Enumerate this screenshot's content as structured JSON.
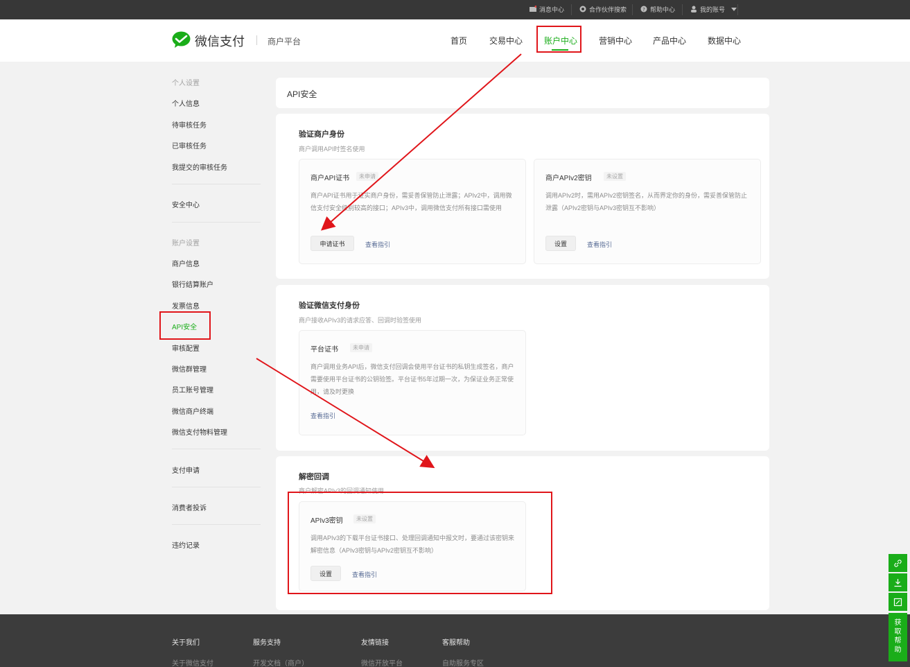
{
  "topbar": {
    "items": [
      {
        "label": "消息中心",
        "icon": "mail-icon"
      },
      {
        "label": "合作伙伴搜索",
        "icon": "partner-icon"
      },
      {
        "label": "帮助中心",
        "icon": "help-icon"
      },
      {
        "label": "我的账号",
        "icon": "user-icon"
      }
    ]
  },
  "header": {
    "logo_text": "微信支付",
    "platform": "商户平台",
    "nav": [
      "首页",
      "交易中心",
      "账户中心",
      "营销中心",
      "产品中心",
      "数据中心"
    ],
    "active_nav": "账户中心"
  },
  "sidebar": {
    "group_personal": "个人设置",
    "personal_items": [
      "个人信息",
      "待审核任务",
      "已审核任务",
      "我提交的审核任务"
    ],
    "security": "安全中心",
    "group_account": "账户设置",
    "account_items": [
      "商户信息",
      "银行结算账户",
      "发票信息",
      "API安全",
      "审核配置",
      "微信群管理",
      "员工账号管理",
      "微信商户终端",
      "微信支付物料管理"
    ],
    "active_item": "API安全",
    "pay_apply": "支付申请",
    "complaint": "消费者投诉",
    "violation": "违约记录"
  },
  "main": {
    "page_title": "API安全",
    "section1": {
      "title": "验证商户身份",
      "desc": "商户调用API时签名使用",
      "card1": {
        "title": "商户API证书",
        "badge": "未申请",
        "desc": "商户API证书用于证实商户身份，需妥善保管防止泄露；APIv2中，调用微信支付安全级别较高的接口；APIv3中，调用微信支付所有接口需使用",
        "button": "申请证书",
        "link": "查看指引"
      },
      "card2": {
        "title": "商户APIv2密钥",
        "badge": "未设置",
        "desc": "调用APIv2时，需用APIv2密钥签名，从而界定你的身份，需妥善保管防止泄露（APIv2密钥与APIv3密钥互不影响）",
        "button": "设置",
        "link": "查看指引"
      }
    },
    "section2": {
      "title": "验证微信支付身份",
      "desc": "商户接收APIv3的请求应答、回调时验签使用",
      "card1": {
        "title": "平台证书",
        "badge": "未申请",
        "desc": "商户调用业务API后，微信支付回调会使用平台证书的私钥生成签名，商户需要使用平台证书的公钥验签。平台证书5年过期一次，为保证业务正常使用，请及时更换",
        "link": "查看指引"
      }
    },
    "section3": {
      "title": "解密回调",
      "desc": "商户解密APIv3的回调通知使用",
      "card1": {
        "title": "APIv3密钥",
        "badge": "未设置",
        "desc": "调用APIv3的下载平台证书接口、处理回调通知中报文时，要通过该密钥来解密信息（APIv3密钥与APIv2密钥互不影响）",
        "button": "设置",
        "link": "查看指引"
      }
    }
  },
  "footer": {
    "headings": [
      "关于我们",
      "服务支持",
      "友情链接",
      "客服帮助"
    ],
    "links": [
      "关于微信支付",
      "开发文档（商户）",
      "微信开放平台",
      "自助服务专区"
    ]
  },
  "float": {
    "help_label": "获取帮助",
    "icons": [
      "link-icon",
      "download-icon",
      "edit-icon"
    ]
  },
  "colors": {
    "brand_green": "#1aad19",
    "annotation_red": "#e0151a",
    "link_blue": "#576b95"
  }
}
